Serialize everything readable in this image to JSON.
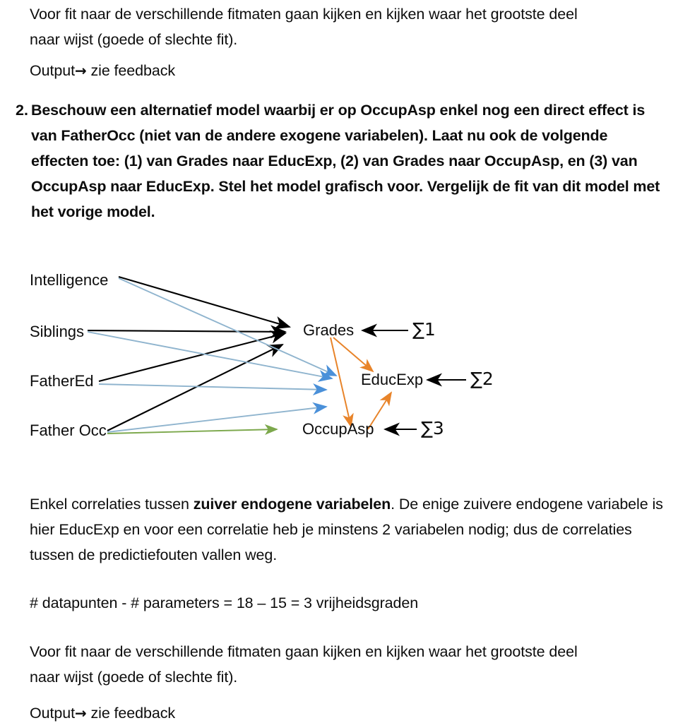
{
  "document": {
    "top_paragraph": {
      "line1": "Voor fit naar de verschillende fitmaten gaan kijken en kijken waar het grootste deel",
      "line2": "naar wijst (goede of slechte fit)."
    },
    "top_output": {
      "label": "Output",
      "arrow": "→",
      "target": "zie feedback"
    },
    "question": {
      "number": "2.",
      "text": "Beschouw een alternatief model waarbij er op OccupAsp enkel nog een direct effect is van FatherOcc (niet van de andere exogene variabelen). Laat nu ook de volgende effecten toe: (1) van Grades naar EducExp, (2) van Grades naar OccupAsp, en (3) van OccupAsp naar EducExp. Stel het model grafisch voor. Vergelijk de fit van dit model met het vorige model."
    },
    "explanation": {
      "lead": "Enkel correlaties tussen ",
      "emphasis": "zuiver endogene variabelen",
      "rest": ". De enige zuivere endogene variabele is hier EducExp en voor een correlatie heb je minstens 2 variabelen nodig; dus de correlaties tussen de predictiefouten vallen weg."
    },
    "df_line": "# datapunten - # parameters = 18 – 15 = 3 vrijheidsgraden",
    "bottom_paragraph": {
      "line1": "Voor fit naar de verschillende fitmaten gaan kijken en kijken waar het grootste deel",
      "line2": "naar wijst (goede of slechte fit)."
    },
    "bottom_output": {
      "label": "Output",
      "arrow": "→",
      "target": "zie feedback"
    }
  },
  "diagram": {
    "title": "path-diagram",
    "exogenous_nodes": [
      {
        "id": "intelligence",
        "label": "Intelligence"
      },
      {
        "id": "siblings",
        "label": "Siblings"
      },
      {
        "id": "fathered",
        "label": "FatherEd"
      },
      {
        "id": "fatherocc",
        "label": "Father Occ"
      }
    ],
    "endogenous_nodes": [
      {
        "id": "grades",
        "label": "Grades"
      },
      {
        "id": "educexp",
        "label": "EducExp"
      },
      {
        "id": "occupasp",
        "label": "OccupAsp"
      }
    ],
    "disturbances": [
      {
        "id": "d1",
        "label": "∑1",
        "target": "Grades"
      },
      {
        "id": "d2",
        "label": "∑2",
        "target": "EducExp"
      },
      {
        "id": "d3",
        "label": "∑3",
        "target": "OccupAsp"
      }
    ],
    "colors": {
      "to_grades": "#000000",
      "to_educexp": "#8FB4CE",
      "to_educexp_head": "#4A90D9",
      "to_occupasp": "#7CA84C",
      "new_effects": "#E8842A",
      "disturbance": "#000000"
    },
    "edges": [
      {
        "from": "Intelligence",
        "to": "Grades",
        "color": "black"
      },
      {
        "from": "Siblings",
        "to": "Grades",
        "color": "black"
      },
      {
        "from": "FatherEd",
        "to": "Grades",
        "color": "black"
      },
      {
        "from": "Father Occ",
        "to": "Grades",
        "color": "black"
      },
      {
        "from": "Intelligence",
        "to": "EducExp",
        "color": "blue"
      },
      {
        "from": "Siblings",
        "to": "EducExp",
        "color": "blue"
      },
      {
        "from": "FatherEd",
        "to": "EducExp",
        "color": "blue"
      },
      {
        "from": "Father Occ",
        "to": "EducExp",
        "color": "blue"
      },
      {
        "from": "Father Occ",
        "to": "OccupAsp",
        "color": "green"
      },
      {
        "from": "Grades",
        "to": "EducExp",
        "color": "orange"
      },
      {
        "from": "Grades",
        "to": "OccupAsp",
        "color": "orange"
      },
      {
        "from": "OccupAsp",
        "to": "EducExp",
        "color": "orange"
      }
    ]
  }
}
